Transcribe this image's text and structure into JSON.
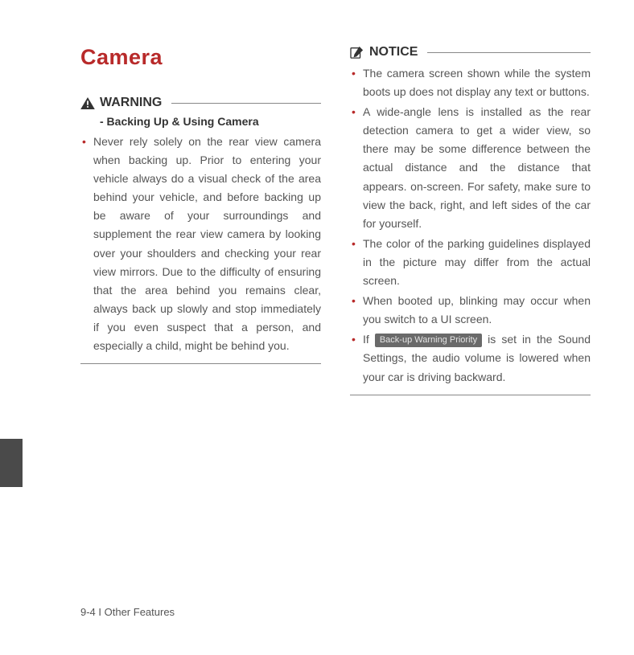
{
  "heading": "Camera",
  "warning": {
    "title": "WARNING",
    "subtitle": "- Backing Up & Using Camera",
    "items": [
      "Never rely solely on the rear view camera when backing up. Prior to entering your vehicle always do a visual check of the area behind your vehicle, and before backing up be aware of your surroundings and supplement the rear view camera by looking over your shoulders and checking your rear view mirrors. Due to the difficulty of ensuring that the area behind you remains clear, always back up slowly and stop immediately if you even suspect that a person, and especially a child, might be behind you."
    ]
  },
  "notice": {
    "title": "NOTICE",
    "items": [
      "The camera screen shown while the system boots up does not display any text or buttons.",
      "A wide-angle lens is installed as the rear detection camera to get a wider view, so there may be some difference between the actual distance and the distance that appears. on-screen. For safety, make sure to view the back, right, and left sides of the car for yourself.",
      "The color of the parking guidelines displayed in the picture may differ from the actual screen.",
      "When booted up, blinking may occur when you switch to a UI screen."
    ],
    "last_item_prefix": "If ",
    "chip_label": "Back-up Warning Priority",
    "last_item_suffix": " is set in the Sound Settings, the audio volume is lowered when your car is driving backward."
  },
  "footer": "9-4 I Other Features"
}
